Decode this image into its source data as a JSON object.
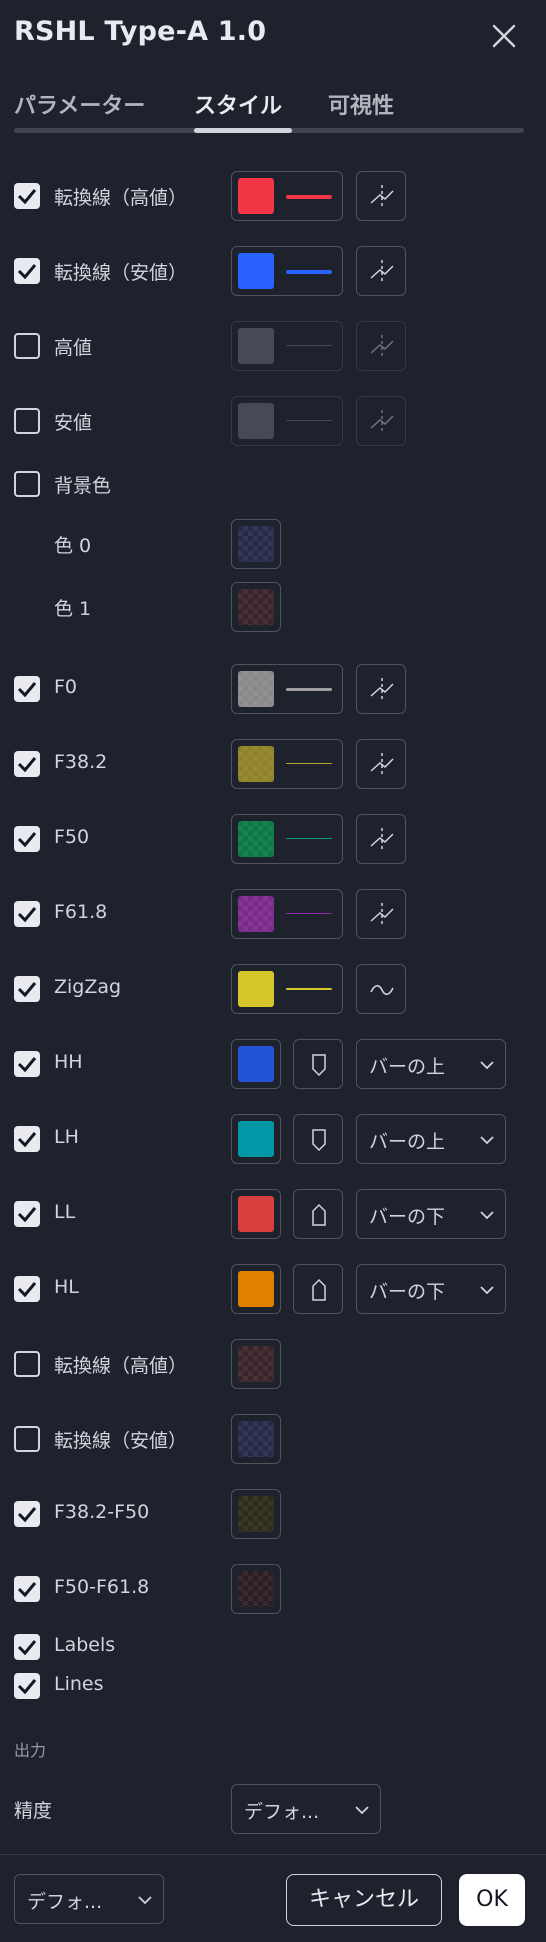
{
  "dialog": {
    "title": "RSHL Type-A 1.0"
  },
  "tabs": [
    {
      "label": "パラメーター"
    },
    {
      "label": "スタイル"
    },
    {
      "label": "可視性"
    }
  ],
  "rows": {
    "r1": {
      "label": "転換線（高値）",
      "checked": true,
      "color": "#f23645"
    },
    "r2": {
      "label": "転換線（安値）",
      "checked": true,
      "color": "#2962ff"
    },
    "r3": {
      "label": "高値",
      "checked": false,
      "color": "#787b86"
    },
    "r4": {
      "label": "安値",
      "checked": false,
      "color": "#787b86"
    },
    "r5": {
      "label": "背景色",
      "checked": false
    },
    "r6": {
      "label": "色 0"
    },
    "r7": {
      "label": "色 1"
    },
    "r8": {
      "label": "F0",
      "checked": true,
      "color": "#9e9e9e"
    },
    "r9": {
      "label": "F38.2",
      "checked": true,
      "color": "#b5a42e"
    },
    "r10": {
      "label": "F50",
      "checked": true,
      "color": "#089981"
    },
    "r11": {
      "label": "F61.8",
      "checked": true,
      "color": "#9c27b0"
    },
    "r12": {
      "label": "ZigZag",
      "checked": true,
      "color": "#d6c62a"
    },
    "r13": {
      "label": "HH",
      "checked": true,
      "color": "#2155d6",
      "location": "バーの上"
    },
    "r14": {
      "label": "LH",
      "checked": true,
      "color": "#0097a7",
      "location": "バーの上"
    },
    "r15": {
      "label": "LL",
      "checked": true,
      "color": "#d84040",
      "location": "バーの下"
    },
    "r16": {
      "label": "HL",
      "checked": true,
      "color": "#e08000",
      "location": "バーの下"
    },
    "r17": {
      "label": "転換線（高値）",
      "checked": false
    },
    "r18": {
      "label": "転換線（安値）",
      "checked": false
    },
    "r19": {
      "label": "F38.2-F50",
      "checked": true
    },
    "r20": {
      "label": "F50-F61.8",
      "checked": true
    },
    "r21": {
      "label": "Labels",
      "checked": true
    },
    "r22": {
      "label": "Lines",
      "checked": true
    }
  },
  "output": {
    "section_label": "出力",
    "precision_label": "精度",
    "precision_value": "デフォ..."
  },
  "footer": {
    "template_label": "デフォ...",
    "cancel_label": "キャンセル",
    "ok_label": "OK"
  }
}
